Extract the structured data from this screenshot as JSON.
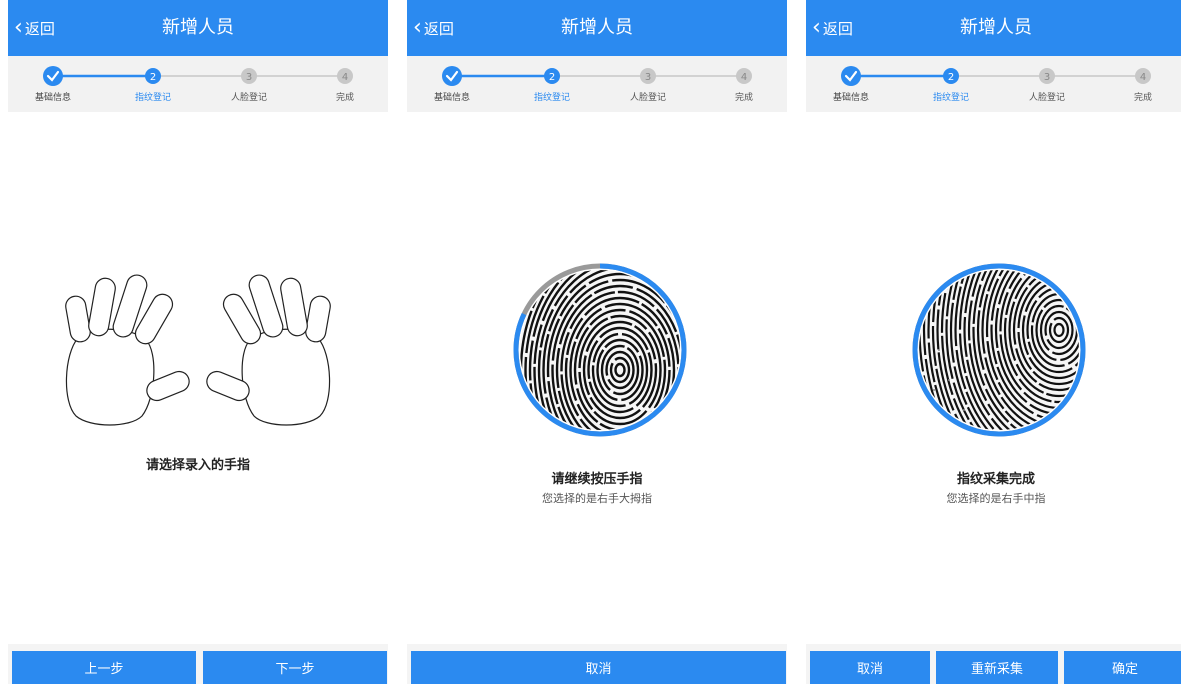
{
  "colors": {
    "primary": "#2b8af0",
    "inactive_step": "#c8c8c8",
    "progress_track": "#9a9a9a"
  },
  "header": {
    "back_label": "返回",
    "back_icon": "chevron-left-icon",
    "title": "新增人员"
  },
  "steps": [
    {
      "number": "1",
      "label": "基础信息",
      "state": "done",
      "icon": "check-icon"
    },
    {
      "number": "2",
      "label": "指纹登记",
      "state": "active"
    },
    {
      "number": "3",
      "label": "人脸登记",
      "state": "pending"
    },
    {
      "number": "4",
      "label": "完成",
      "state": "pending"
    }
  ],
  "screens": {
    "select": {
      "prompt": "请选择录入的手指",
      "buttons": {
        "prev": "上一步",
        "next": "下一步"
      }
    },
    "capturing": {
      "prompt": "请继续按压手指",
      "finger": "您选择的是右手大拇指",
      "progress": 0.82,
      "buttons": {
        "cancel": "取消"
      }
    },
    "complete": {
      "prompt": "指纹采集完成",
      "finger": "您选择的是右手中指",
      "progress": 1.0,
      "buttons": {
        "cancel": "取消",
        "recapture": "重新采集",
        "confirm": "确定"
      }
    }
  }
}
